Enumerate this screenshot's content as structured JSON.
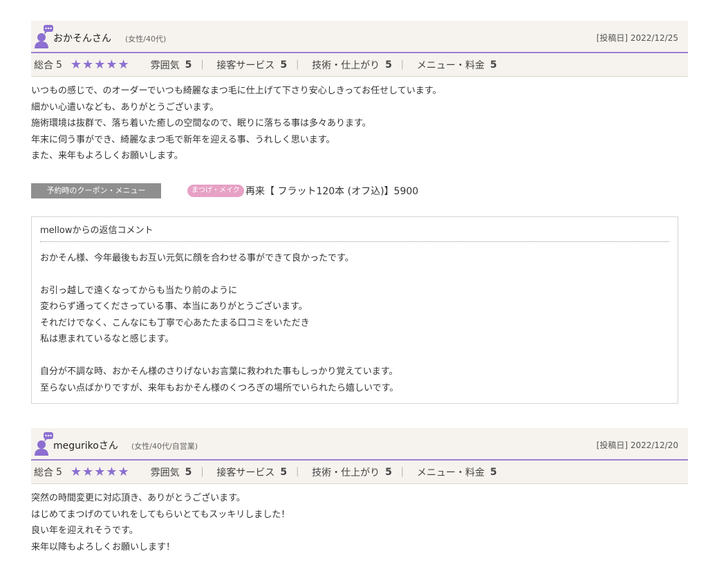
{
  "reviews": [
    {
      "name": "おかそんさん",
      "attributes": "(女性/40代)",
      "post_date": "[投稿日] 2022/12/25",
      "overall_label": "総合",
      "overall_score": "5",
      "stars": "★★★★★",
      "categories": [
        {
          "label": "雰囲気",
          "score": "5"
        },
        {
          "label": "接客サービス",
          "score": "5"
        },
        {
          "label": "技術・仕上がり",
          "score": "5"
        },
        {
          "label": "メニュー・料金",
          "score": "5"
        }
      ],
      "body": [
        "いつもの感じで、のオーダーでいつも綺麗なまつ毛に仕上げて下さり安心しきってお任せしています。",
        "細かい心遣いなども、ありがとうございます。",
        "施術環境は抜群で、落ち着いた癒しの空間なので、眠りに落ちる事は多々あります。",
        "年末に伺う事ができ、綺麗なまつ毛で新年を迎える事、うれしく思います。",
        "また、来年もよろしくお願いします。"
      ],
      "coupon": {
        "label": "予約時のクーポン・メニュー",
        "tag": "まつげ・メイク",
        "text": "再来【 フラット120本 (オフ込)】5900"
      },
      "reply": {
        "title": "mellowからの返信コメント",
        "paragraph1": [
          "おかそん様、今年最後もお互い元気に顔を合わせる事ができて良かったです。"
        ],
        "paragraph2": [
          "お引っ越しで遠くなってからも当たり前のように",
          "変わらず通ってくださっている事、本当にありがとうございます。",
          "それだけでなく、こんなにも丁寧で心あたたまる口コミをいただき",
          "私は恵まれているなと感じます。"
        ],
        "paragraph3": [
          "自分が不調な時、おかそん様のさりげないお言葉に救われた事もしっかり覚えています。",
          "至らない点ばかりですが、来年もおかそん様のくつろぎの場所でいられたら嬉しいです。"
        ]
      }
    },
    {
      "name": "megurikoさん",
      "attributes": "(女性/40代/自営業)",
      "post_date": "[投稿日] 2022/12/20",
      "overall_label": "総合",
      "overall_score": "5",
      "stars": "★★★★★",
      "categories": [
        {
          "label": "雰囲気",
          "score": "5"
        },
        {
          "label": "接客サービス",
          "score": "5"
        },
        {
          "label": "技術・仕上がり",
          "score": "5"
        },
        {
          "label": "メニュー・料金",
          "score": "5"
        }
      ],
      "body": [
        "突然の時間変更に対応頂き、ありがとうございます。",
        "はじめてまつげのていれをしてもらいとてもスッキリしました！",
        "良い年を迎えれそうです。",
        "来年以降もよろしくお願いします！"
      ]
    }
  ],
  "separator": "｜",
  "icons": {
    "user": "user-comment-icon"
  },
  "colors": {
    "accent": "#9b7fd1",
    "stars": "#8c6fd0",
    "header_bg": "#f6f3ee",
    "coupon_tag": "#e7a1c5"
  }
}
